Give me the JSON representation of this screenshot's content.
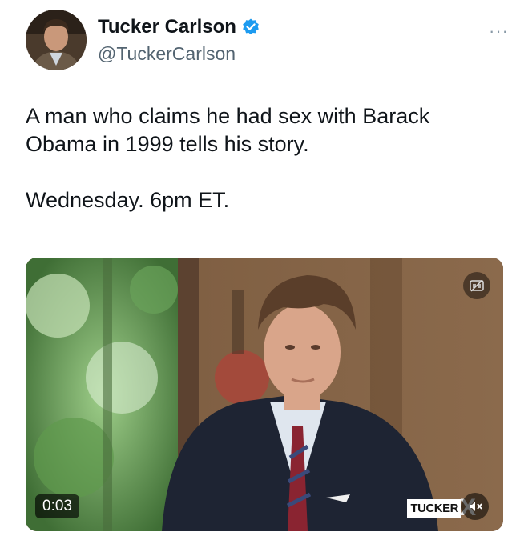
{
  "author": {
    "display_name": "Tucker Carlson",
    "handle": "@TuckerCarlson",
    "verified": true,
    "avatar_icon": "profile-photo",
    "verified_icon": "verified-badge-icon",
    "verified_color": "#1d9bf0"
  },
  "tweet": {
    "line1": "A man who claims he had sex with Barack",
    "line2": "Obama in 1999 tells his story.",
    "line3": "Wednesday. 6pm ET."
  },
  "menu": {
    "more_label": "···"
  },
  "video": {
    "duration": "0:03",
    "captions_icon": "captions-icon",
    "mute_icon": "muted-speaker-icon",
    "logo_text": "TUCKER",
    "logo_mark": "X"
  }
}
